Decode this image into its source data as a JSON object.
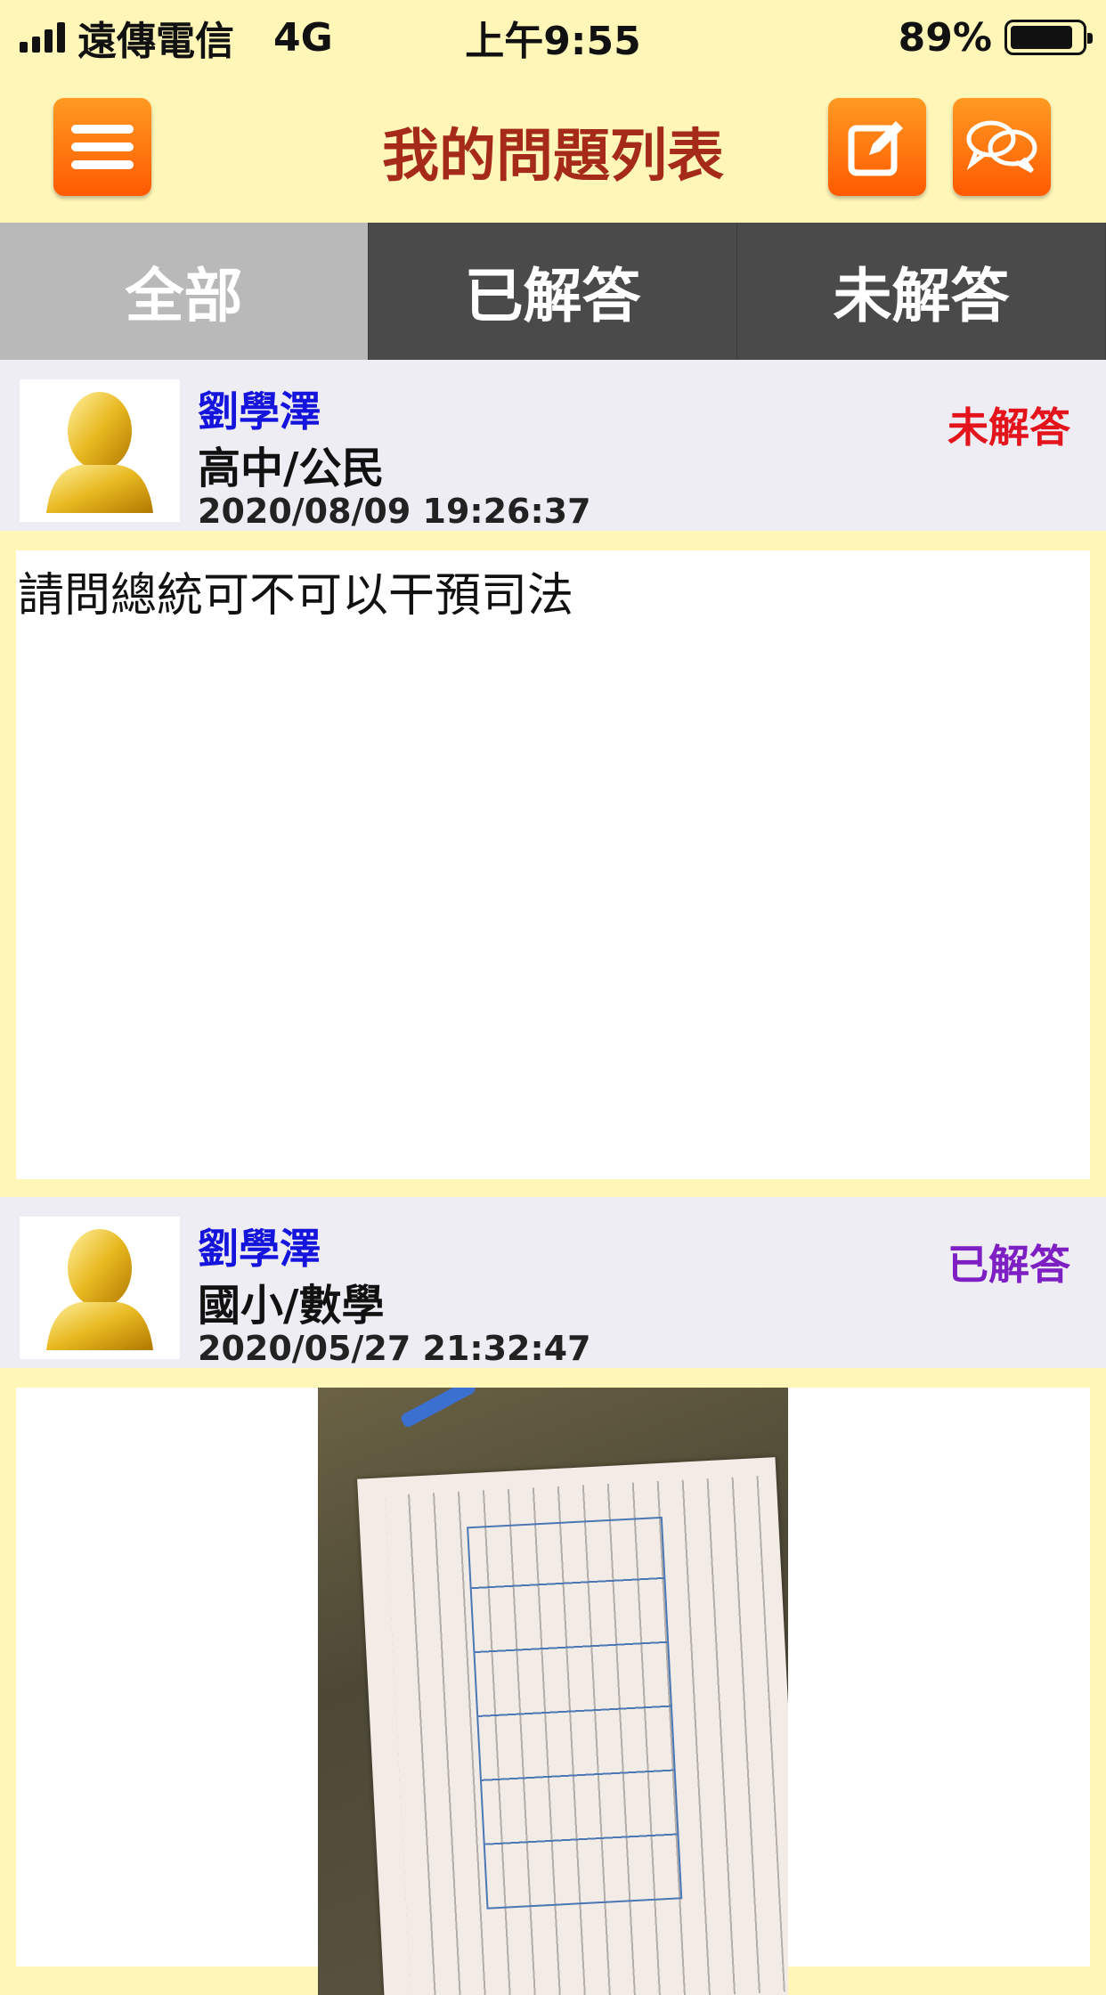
{
  "status_bar": {
    "carrier": "遠傳電信",
    "network": "4G",
    "time": "上午9:55",
    "battery": "89%",
    "battery_level": 0.89
  },
  "nav": {
    "title": "我的問題列表",
    "left_icon": "menu-icon",
    "right_icons": [
      "compose-icon",
      "chat-icon"
    ]
  },
  "tabs": [
    {
      "label": "全部",
      "active": true
    },
    {
      "label": "已解答",
      "active": false
    },
    {
      "label": "未解答",
      "active": false
    }
  ],
  "questions": [
    {
      "name": "劉學澤",
      "subject": "高中/公民",
      "time": "2020/08/09 19:26:37",
      "status": "未解答",
      "text": "請問總統可不可以干預司法"
    },
    {
      "name": "劉學澤",
      "subject": "國小/數學",
      "time": "2020/05/27 21:32:47",
      "status": "已解答",
      "text": ""
    }
  ],
  "colors": {
    "background": "#fff6b8",
    "title": "#a52a1a",
    "name": "#1414dd",
    "unanswered": "#e4141c",
    "answered": "#7d1fc2",
    "button": "#ff6a00"
  }
}
